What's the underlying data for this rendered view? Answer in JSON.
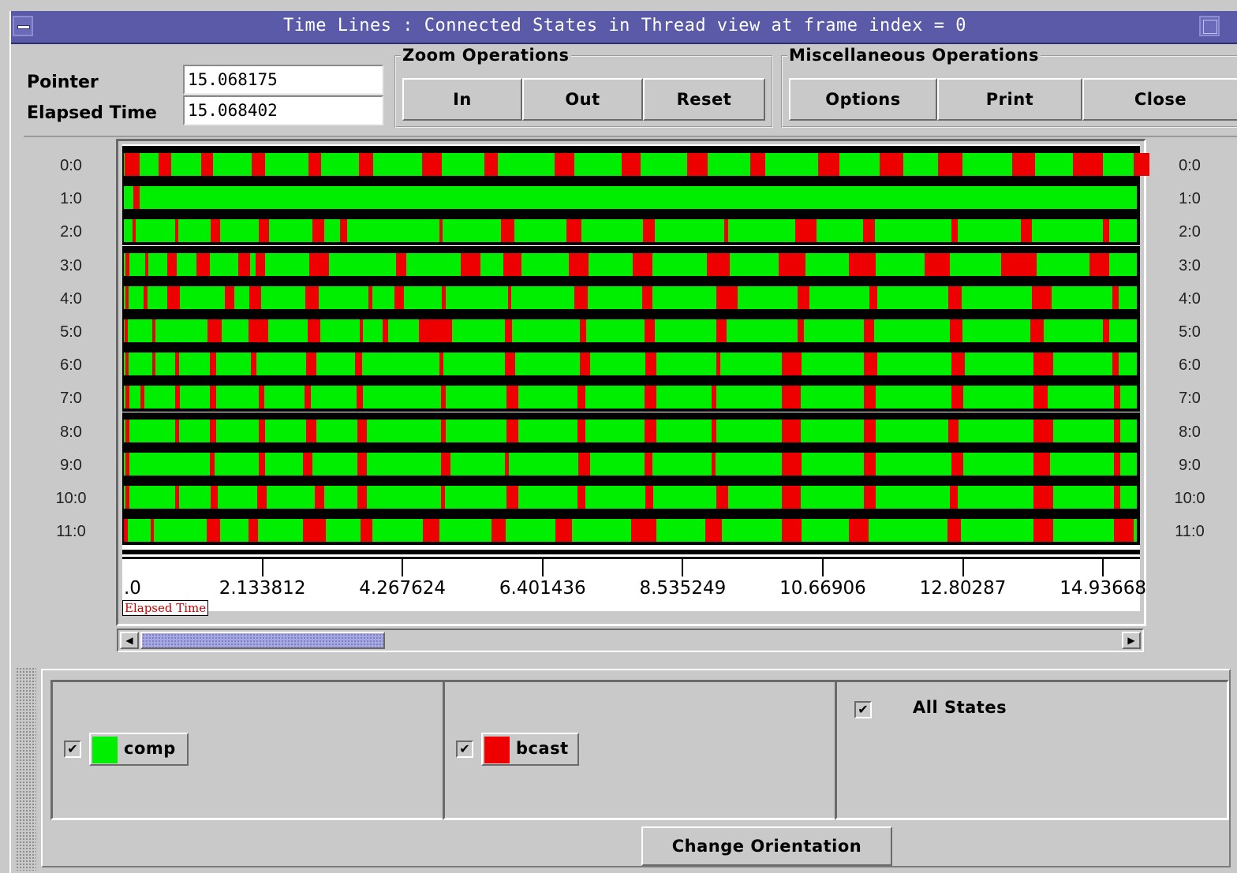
{
  "window": {
    "title": "Time Lines : Connected States in Thread view at frame index = 0"
  },
  "info": {
    "pointer_label": "Pointer",
    "pointer_value": "15.068175",
    "elapsed_label": "Elapsed Time",
    "elapsed_value": "15.068402"
  },
  "zoom": {
    "title": "Zoom Operations",
    "in_label": "In",
    "out_label": "Out",
    "reset_label": "Reset"
  },
  "misc": {
    "title": "Miscellaneous Operations",
    "options_label": "Options",
    "print_label": "Print",
    "close_label": "Close"
  },
  "threads": [
    "0:0",
    "1:0",
    "2:0",
    "3:0",
    "4:0",
    "5:0",
    "6:0",
    "7:0",
    "8:0",
    "9:0",
    "10:0",
    "11:0"
  ],
  "axis": {
    "ticks": [
      ".0",
      "2.133812",
      "4.267624",
      "6.401436",
      "8.535249",
      "10.66906",
      "12.80287",
      "14.93668"
    ],
    "label": "Elapsed Time"
  },
  "legend": {
    "comp": {
      "label": "comp",
      "checked": true,
      "color": "#00ee00"
    },
    "bcast": {
      "label": "bcast",
      "checked": true,
      "color": "#ee0000"
    },
    "all_states": {
      "label": "All States",
      "checked": true
    },
    "check_mark": "✔"
  },
  "change_orientation_label": "Change Orientation",
  "colors": {
    "comp": "#00ee00",
    "bcast": "#ee0000",
    "canvas_bg": "#ffffff",
    "title_bar": "#5a5aa8"
  },
  "chart_data": {
    "type": "timeline",
    "xlim": [
      0,
      15.5
    ],
    "rows": [
      {
        "thread": "0:0",
        "bcast_at": [
          0.04,
          0.55,
          1.2,
          1.97,
          2.83,
          3.6,
          4.57,
          5.52,
          6.58,
          7.6,
          8.6,
          9.57,
          10.6,
          11.54,
          12.42,
          13.55,
          14.48,
          15.4
        ],
        "bcast_len": [
          0.22,
          0.2,
          0.18,
          0.2,
          0.2,
          0.22,
          0.3,
          0.2,
          0.3,
          0.3,
          0.32,
          0.22,
          0.32,
          0.35,
          0.38,
          0.35,
          0.45,
          0.25
        ]
      },
      {
        "thread": "1:0",
        "bcast_at": [
          0.17
        ],
        "bcast_len": [
          0.1
        ]
      },
      {
        "thread": "2:0",
        "bcast_at": [
          0.16,
          0.8,
          1.34,
          2.08,
          2.9,
          3.32,
          4.83,
          5.77,
          6.77,
          7.93,
          9.17,
          10.25,
          11.28,
          12.63,
          13.68,
          14.93
        ],
        "bcast_len": [
          0.05,
          0.05,
          0.15,
          0.15,
          0.18,
          0.1,
          0.05,
          0.2,
          0.22,
          0.18,
          0.06,
          0.32,
          0.18,
          0.1,
          0.18,
          0.1
        ]
      },
      {
        "thread": "3:0",
        "bcast_at": [
          0.05,
          0.35,
          0.68,
          1.13,
          1.77,
          2.03,
          2.85,
          4.17,
          5.15,
          5.8,
          6.8,
          7.77,
          8.9,
          10.0,
          11.07,
          12.22,
          13.38,
          14.73
        ],
        "bcast_len": [
          0.06,
          0.05,
          0.15,
          0.2,
          0.18,
          0.14,
          0.3,
          0.15,
          0.3,
          0.28,
          0.3,
          0.3,
          0.35,
          0.4,
          0.4,
          0.38,
          0.55,
          0.3
        ]
      },
      {
        "thread": "4:0",
        "bcast_at": [
          0.05,
          0.33,
          0.68,
          1.56,
          1.93,
          2.79,
          3.75,
          4.14,
          4.87,
          5.87,
          6.89,
          7.92,
          9.05,
          10.28,
          11.38,
          12.58,
          13.85,
          15.08
        ],
        "bcast_len": [
          0.05,
          0.05,
          0.2,
          0.15,
          0.18,
          0.2,
          0.06,
          0.15,
          0.06,
          0.05,
          0.2,
          0.15,
          0.32,
          0.18,
          0.12,
          0.2,
          0.3,
          0.1
        ]
      },
      {
        "thread": "5:0",
        "bcast_at": [
          0.04,
          0.46,
          1.3,
          1.92,
          2.82,
          3.62,
          3.97,
          4.52,
          5.83,
          6.97,
          7.95,
          9.05,
          10.28,
          11.3,
          12.6,
          13.83,
          14.93
        ],
        "bcast_len": [
          0.05,
          0.05,
          0.22,
          0.3,
          0.2,
          0.05,
          0.08,
          0.5,
          0.1,
          0.1,
          0.16,
          0.15,
          0.1,
          0.15,
          0.2,
          0.2,
          0.1
        ]
      },
      {
        "thread": "6:0",
        "bcast_at": [
          0.05,
          0.46,
          0.81,
          1.33,
          1.96,
          2.8,
          3.55,
          4.83,
          5.83,
          6.97,
          7.97,
          9.05,
          10.05,
          11.3,
          12.63,
          13.88,
          15.08
        ],
        "bcast_len": [
          0.05,
          0.05,
          0.05,
          0.1,
          0.08,
          0.15,
          0.1,
          0.06,
          0.15,
          0.15,
          0.16,
          0.06,
          0.3,
          0.2,
          0.2,
          0.3,
          0.1
        ]
      },
      {
        "thread": "7:0",
        "bcast_at": [
          0.05,
          0.28,
          0.8,
          1.33,
          2.08,
          2.77,
          3.57,
          4.85,
          5.85,
          6.93,
          7.95,
          8.97,
          10.05,
          11.3,
          12.63,
          13.88,
          15.1
        ],
        "bcast_len": [
          0.06,
          0.06,
          0.08,
          0.1,
          0.08,
          0.1,
          0.1,
          0.08,
          0.18,
          0.12,
          0.18,
          0.08,
          0.28,
          0.18,
          0.18,
          0.22,
          0.1
        ]
      },
      {
        "thread": "8:0",
        "bcast_at": [
          0.05,
          0.8,
          1.33,
          2.08,
          2.8,
          3.58,
          4.85,
          5.85,
          6.93,
          7.95,
          8.97,
          10.05,
          11.3,
          12.58,
          13.88,
          15.1
        ],
        "bcast_len": [
          0.06,
          0.06,
          0.1,
          0.1,
          0.15,
          0.15,
          0.08,
          0.18,
          0.12,
          0.18,
          0.08,
          0.28,
          0.18,
          0.16,
          0.3,
          0.1
        ]
      },
      {
        "thread": "9:0",
        "bcast_at": [
          0.05,
          1.33,
          2.08,
          2.75,
          3.58,
          4.85,
          5.83,
          6.95,
          7.95,
          8.97,
          10.05,
          11.3,
          12.63,
          13.88,
          15.1
        ],
        "bcast_len": [
          0.06,
          0.08,
          0.1,
          0.15,
          0.15,
          0.15,
          0.06,
          0.18,
          0.12,
          0.06,
          0.3,
          0.18,
          0.18,
          0.25,
          0.1
        ]
      },
      {
        "thread": "10:0",
        "bcast_at": [
          0.05,
          0.8,
          1.35,
          2.05,
          2.93,
          3.58,
          4.85,
          5.85,
          6.93,
          7.97,
          9.05,
          10.05,
          11.3,
          12.6,
          13.88,
          15.1
        ],
        "bcast_len": [
          0.06,
          0.06,
          0.1,
          0.15,
          0.15,
          0.15,
          0.06,
          0.18,
          0.12,
          0.12,
          0.18,
          0.28,
          0.18,
          0.12,
          0.3,
          0.1
        ]
      },
      {
        "thread": "11:0",
        "bcast_at": [
          0.03,
          0.43,
          1.29,
          1.92,
          2.75,
          3.63,
          4.58,
          5.62,
          6.6,
          7.75,
          8.88,
          10.05,
          11.07,
          12.57,
          13.88,
          15.1
        ],
        "bcast_len": [
          0.05,
          0.05,
          0.2,
          0.15,
          0.35,
          0.18,
          0.25,
          0.22,
          0.25,
          0.38,
          0.25,
          0.3,
          0.3,
          0.2,
          0.3,
          0.3
        ]
      }
    ]
  }
}
